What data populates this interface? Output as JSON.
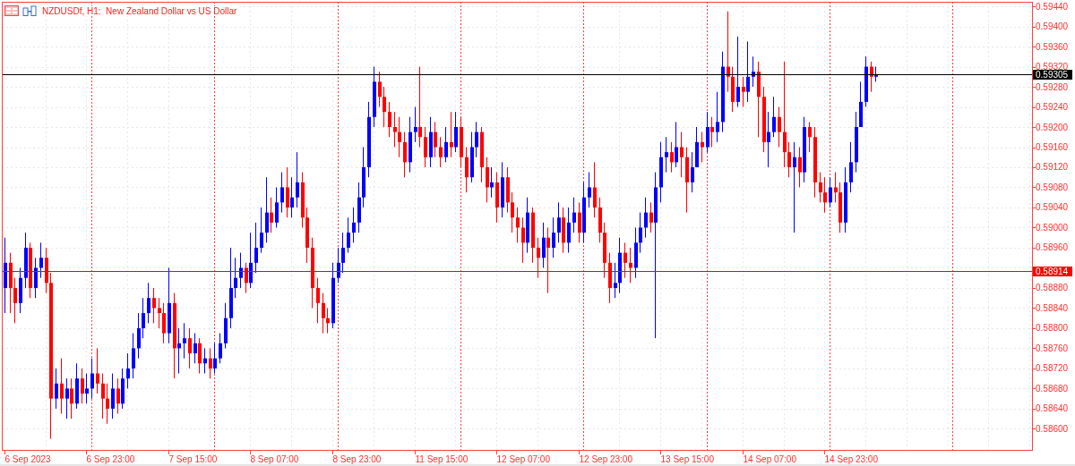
{
  "chart": {
    "title": "NZDUSDf, H1:  New Zealand Dollar vs US Dollar",
    "price_axis": [
      "0.59440",
      "0.59400",
      "0.59360",
      "0.59320",
      "0.59280",
      "0.59240",
      "0.59200",
      "0.59160",
      "0.59120",
      "0.59080",
      "0.59040",
      "0.59000",
      "0.58960",
      "0.58880",
      "0.58840",
      "0.58800",
      "0.58760",
      "0.58720",
      "0.58680",
      "0.58640",
      "0.58600"
    ],
    "price_tags": [
      {
        "label": "0.59305",
        "color": "#000000"
      },
      {
        "label": "0.58914",
        "color": "#ff0000"
      }
    ],
    "time_axis": [
      "6 Sep 2023",
      "6 Sep 23:00",
      "7 Sep 15:00",
      "8 Sep 07:00",
      "8 Sep 23:00",
      "11 Sep 15:00",
      "12 Sep 07:00",
      "12 Sep 23:00",
      "13 Sep 15:00",
      "14 Sep 07:00",
      "14 Sep 23:00"
    ]
  }
}
